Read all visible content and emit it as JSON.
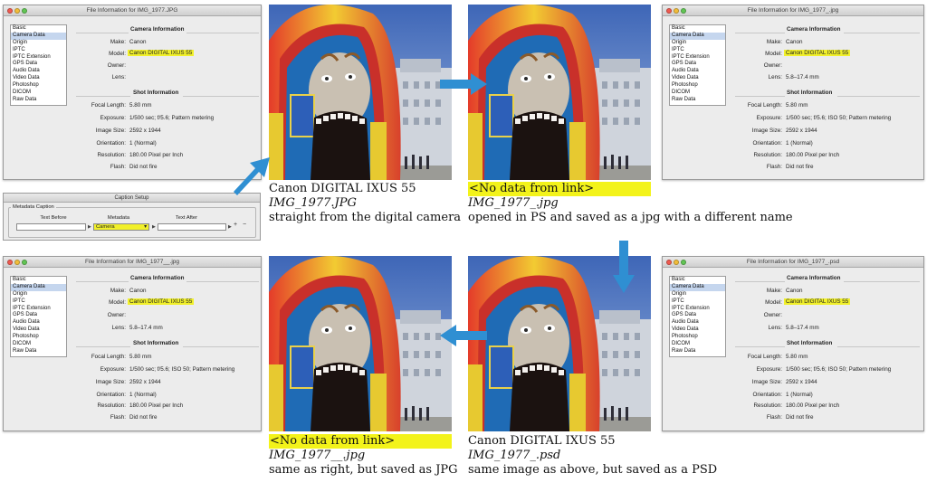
{
  "dialogs": {
    "d1": {
      "title": "File Information for IMG_1977.JPG",
      "camera": {
        "make": "Canon",
        "model": "Canon DIGITAL IXUS 55",
        "owner": "",
        "lens": ""
      },
      "shot": {
        "focal_length": "5.80 mm",
        "exposure": "1/500 sec;   f/5.6;   Pattern metering",
        "image_size": "2592 x 1944",
        "orientation": "1 (Normal)",
        "resolution": "180.00 Pixel per Inch",
        "flash": "Did not fire"
      }
    },
    "d2": {
      "title": "File Information for IMG_1977_.jpg",
      "camera": {
        "make": "Canon",
        "model": "Canon DIGITAL IXUS 55",
        "owner": "",
        "lens": "5.8–17.4 mm"
      },
      "shot": {
        "focal_length": "5.80 mm",
        "exposure": "1/500 sec;   f/5.6;   ISO 50;   Pattern metering",
        "image_size": "2592 x 1944",
        "orientation": "1 (Normal)",
        "resolution": "180.00 Pixel per Inch",
        "flash": "Did not fire"
      }
    },
    "d3": {
      "title": "File Information for IMG_1977__.jpg",
      "camera": {
        "make": "Canon",
        "model": "Canon DIGITAL IXUS 55",
        "owner": "",
        "lens": "5.8–17.4 mm"
      },
      "shot": {
        "focal_length": "5.80 mm",
        "exposure": "1/500 sec;   f/5.6;   ISO 50;   Pattern metering",
        "image_size": "2592 x 1944",
        "orientation": "1 (Normal)",
        "resolution": "180.00 Pixel per Inch",
        "flash": "Did not fire"
      }
    },
    "d4": {
      "title": "File Information for IMG_1977_.psd",
      "camera": {
        "make": "Canon",
        "model": "Canon DIGITAL IXUS 55",
        "owner": "",
        "lens": "5.8–17.4 mm"
      },
      "shot": {
        "focal_length": "5.80 mm",
        "exposure": "1/500 sec;   f/5.6;   ISO 50;   Pattern metering",
        "image_size": "2592 x 1944",
        "orientation": "1 (Normal)",
        "resolution": "180.00 Pixel per Inch",
        "flash": "Did not fire"
      }
    }
  },
  "categories": [
    "Basic",
    "Camera Data",
    "Origin",
    "IPTC",
    "IPTC Extension",
    "GPS Data",
    "Audio Data",
    "Video Data",
    "Photoshop",
    "DICOM",
    "Raw Data"
  ],
  "selected_category": "Camera Data",
  "labels": {
    "camera_information": "Camera Information",
    "shot_information": "Shot Information",
    "make": "Make:",
    "model": "Model:",
    "owner": "Owner:",
    "lens": "Lens:",
    "focal_length": "Focal Length:",
    "exposure": "Exposure:",
    "image_size": "Image Size:",
    "orientation": "Orientation:",
    "resolution": "Resolution:",
    "flash": "Flash:"
  },
  "caption_setup": {
    "title": "Caption Setup",
    "group": "Metadata Caption",
    "text_before": "Text Before",
    "metadata": "Metadata",
    "text_after": "Text After",
    "selected": "Camera",
    "plus": "+",
    "minus": "−"
  },
  "captions": {
    "c1": {
      "line1": "Canon DIGITAL IXUS 55",
      "line2": "IMG_1977.JPG",
      "line3": "straight from the digital camera"
    },
    "c2": {
      "line1": "<No data from link>",
      "line2": "IMG_1977_.jpg",
      "line3": "opened in PS and saved as a jpg with a different name"
    },
    "c3": {
      "line1": "<No data from link>",
      "line2": "IMG_1977__.jpg",
      "line3": "same as right, but saved as JPG"
    },
    "c4": {
      "line1": "Canon DIGITAL IXUS 55",
      "line2": "IMG_1977_.psd",
      "line3": "same image as above, but saved as a PSD"
    }
  },
  "colors": {
    "highlight": "#f3f31a",
    "arrow": "#2f8fd2",
    "selection": "#c5d6ee"
  }
}
